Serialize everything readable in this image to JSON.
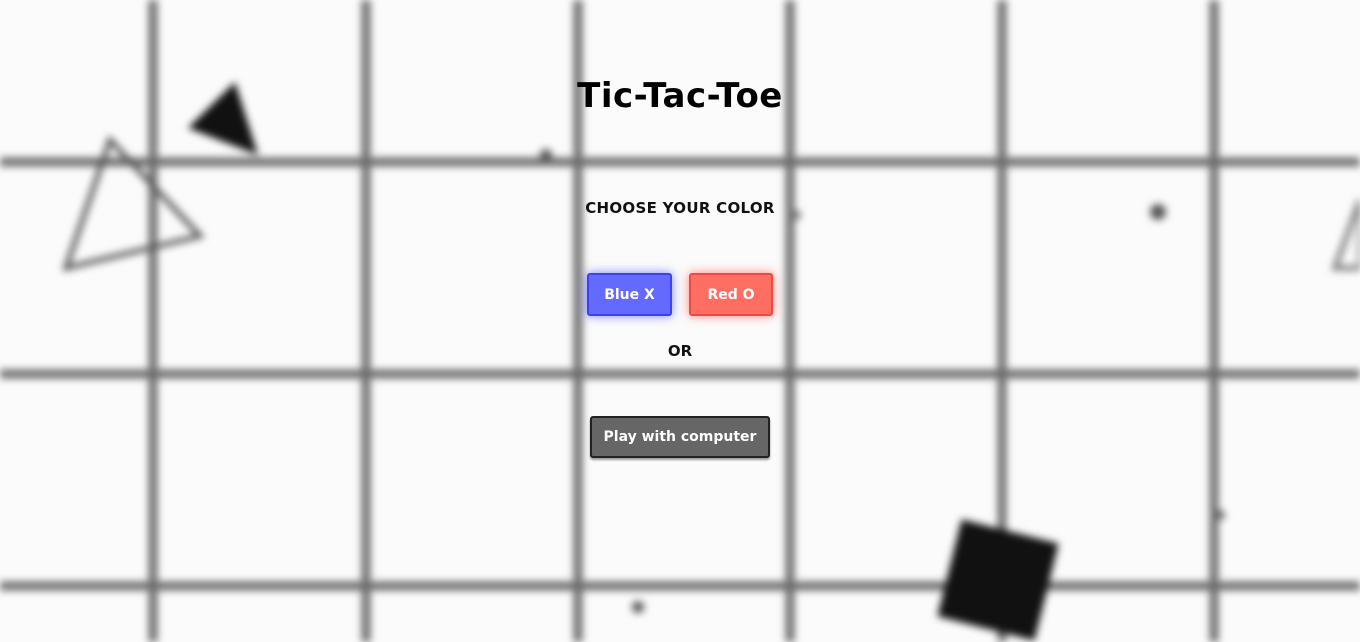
{
  "page": {
    "title": "Tic-Tac-Toe",
    "subtitle": "CHOOSE YOUR COLOR",
    "separator": "OR"
  },
  "buttons": {
    "blue_label": "Blue X",
    "red_label": "Red O",
    "computer_label": "Play with computer"
  },
  "colors": {
    "blue": "#6469ff",
    "red": "#ff6e63",
    "computer_button": "#666666",
    "background": "#fbfbfb"
  }
}
